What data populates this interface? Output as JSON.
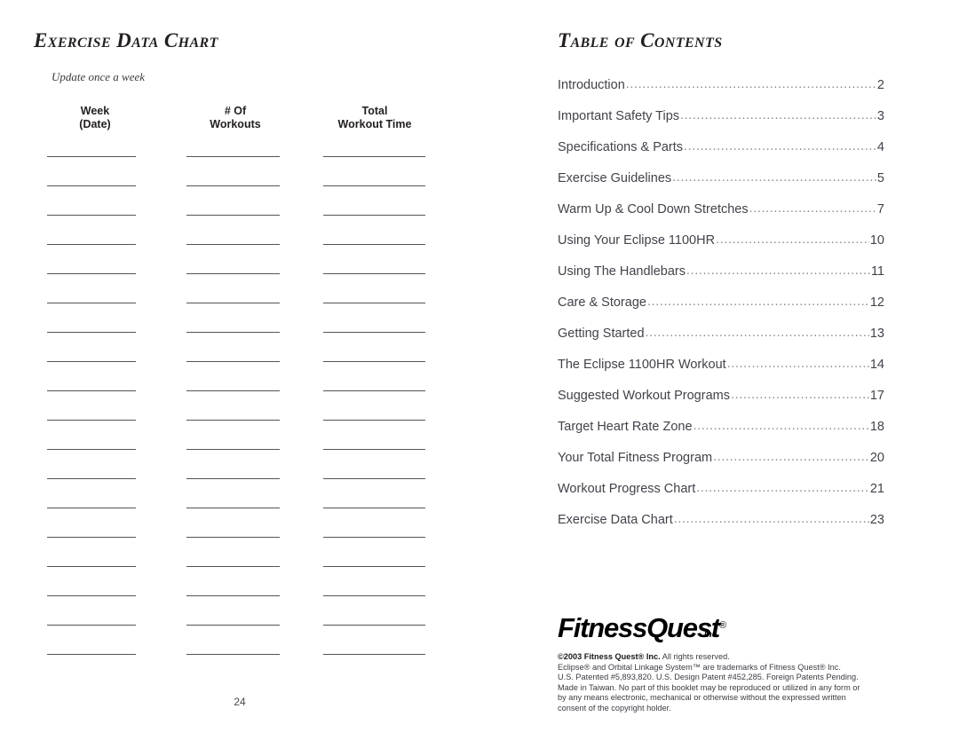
{
  "left_page": {
    "heading": "Exercise Data Chart",
    "note": "Update once a week",
    "columns": [
      {
        "line1": "Week",
        "line2": "(Date)"
      },
      {
        "line1": "# Of",
        "line2": "Workouts"
      },
      {
        "line1": "Total",
        "line2": "Workout Time"
      }
    ],
    "blank_row_count": 18,
    "page_number": "24"
  },
  "right_page": {
    "heading": "Table of Contents",
    "entries": [
      {
        "label": "Introduction",
        "page": "2"
      },
      {
        "label": "Important Safety Tips",
        "page": "3"
      },
      {
        "label": "Specifications & Parts",
        "page": "4"
      },
      {
        "label": "Exercise Guidelines",
        "page": "5"
      },
      {
        "label": "Warm Up & Cool Down Stretches",
        "page": "7"
      },
      {
        "label": "Using Your Eclipse 1100HR",
        "page": "10"
      },
      {
        "label": "Using The Handlebars",
        "page": "11"
      },
      {
        "label": "Care & Storage",
        "page": "12"
      },
      {
        "label": "Getting Started",
        "page": "13"
      },
      {
        "label": "The Eclipse 1100HR Workout",
        "page": "14"
      },
      {
        "label": "Suggested Workout Programs",
        "page": "17"
      },
      {
        "label": "Target Heart Rate Zone",
        "page": "18"
      },
      {
        "label": "Your Total Fitness Program",
        "page": "20"
      },
      {
        "label": "Workout Progress Chart",
        "page": "21"
      },
      {
        "label": "Exercise Data Chart",
        "page": "23"
      }
    ],
    "logo": {
      "name": "FitnessQuest",
      "registered_mark": "®",
      "suffix": "Inc."
    },
    "copyright": {
      "line1_strong": "©2003 Fitness Quest® Inc.",
      "line1_rest": " All rights reserved.",
      "line2": "Eclipse® and Orbital Linkage System™ are trademarks of Fitness Quest® Inc.",
      "line3": "U.S. Patented #5,893,820. U.S. Design Patent #452,285. Foreign Patents Pending.",
      "line4": "Made in Taiwan. No part of this booklet may be reproduced or utilized in any form or",
      "line5": "by any means electronic, mechanical or otherwise without the expressed written",
      "line6": "consent of the copyright holder."
    }
  },
  "colors": {
    "text": "#231f20",
    "muted_text": "#44414a",
    "rule": "#55525a",
    "dots": "#8d8a92",
    "page_background": "#ffffff"
  }
}
